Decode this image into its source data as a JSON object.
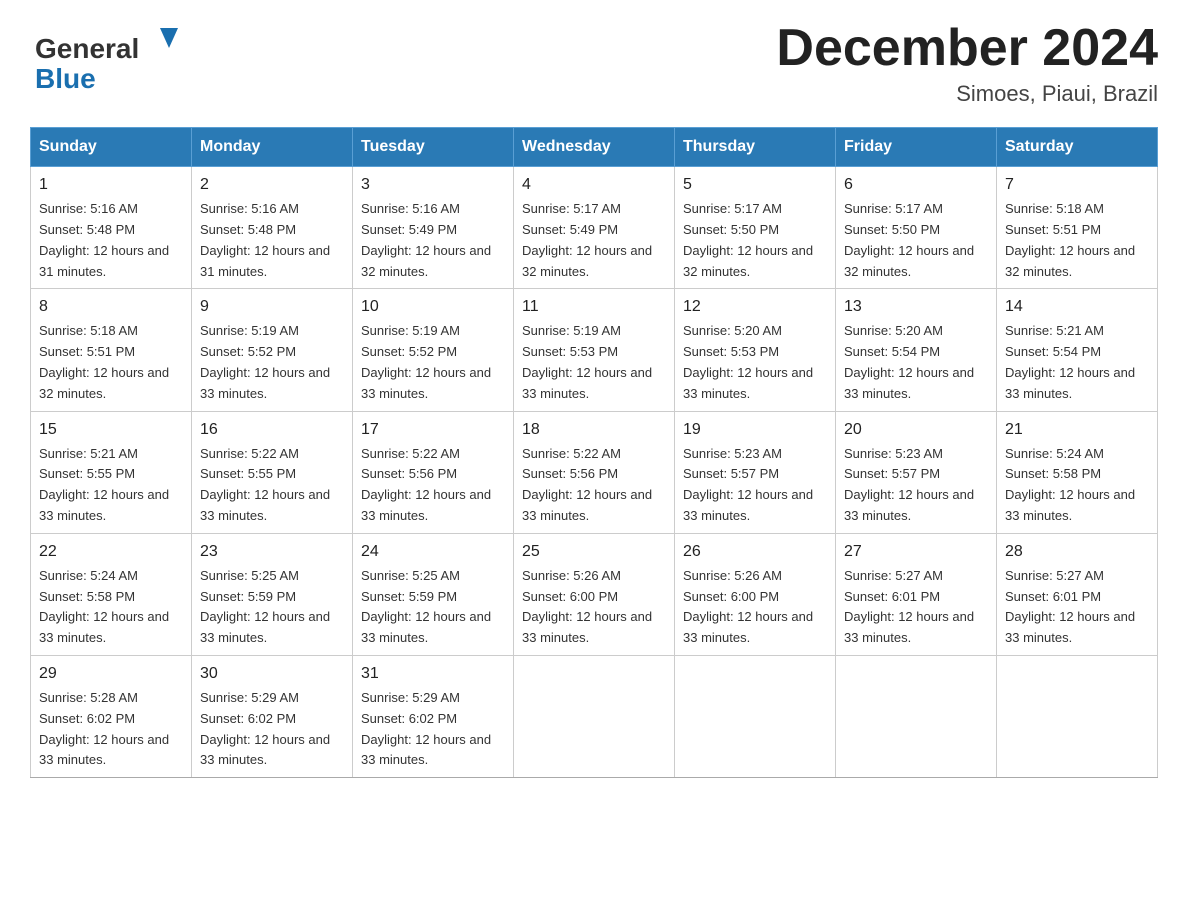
{
  "logo": {
    "general": "General",
    "blue": "Blue"
  },
  "title": {
    "month_year": "December 2024",
    "location": "Simoes, Piaui, Brazil"
  },
  "weekdays": [
    "Sunday",
    "Monday",
    "Tuesday",
    "Wednesday",
    "Thursday",
    "Friday",
    "Saturday"
  ],
  "weeks": [
    [
      {
        "day": "1",
        "sunrise": "Sunrise: 5:16 AM",
        "sunset": "Sunset: 5:48 PM",
        "daylight": "Daylight: 12 hours and 31 minutes."
      },
      {
        "day": "2",
        "sunrise": "Sunrise: 5:16 AM",
        "sunset": "Sunset: 5:48 PM",
        "daylight": "Daylight: 12 hours and 31 minutes."
      },
      {
        "day": "3",
        "sunrise": "Sunrise: 5:16 AM",
        "sunset": "Sunset: 5:49 PM",
        "daylight": "Daylight: 12 hours and 32 minutes."
      },
      {
        "day": "4",
        "sunrise": "Sunrise: 5:17 AM",
        "sunset": "Sunset: 5:49 PM",
        "daylight": "Daylight: 12 hours and 32 minutes."
      },
      {
        "day": "5",
        "sunrise": "Sunrise: 5:17 AM",
        "sunset": "Sunset: 5:50 PM",
        "daylight": "Daylight: 12 hours and 32 minutes."
      },
      {
        "day": "6",
        "sunrise": "Sunrise: 5:17 AM",
        "sunset": "Sunset: 5:50 PM",
        "daylight": "Daylight: 12 hours and 32 minutes."
      },
      {
        "day": "7",
        "sunrise": "Sunrise: 5:18 AM",
        "sunset": "Sunset: 5:51 PM",
        "daylight": "Daylight: 12 hours and 32 minutes."
      }
    ],
    [
      {
        "day": "8",
        "sunrise": "Sunrise: 5:18 AM",
        "sunset": "Sunset: 5:51 PM",
        "daylight": "Daylight: 12 hours and 32 minutes."
      },
      {
        "day": "9",
        "sunrise": "Sunrise: 5:19 AM",
        "sunset": "Sunset: 5:52 PM",
        "daylight": "Daylight: 12 hours and 33 minutes."
      },
      {
        "day": "10",
        "sunrise": "Sunrise: 5:19 AM",
        "sunset": "Sunset: 5:52 PM",
        "daylight": "Daylight: 12 hours and 33 minutes."
      },
      {
        "day": "11",
        "sunrise": "Sunrise: 5:19 AM",
        "sunset": "Sunset: 5:53 PM",
        "daylight": "Daylight: 12 hours and 33 minutes."
      },
      {
        "day": "12",
        "sunrise": "Sunrise: 5:20 AM",
        "sunset": "Sunset: 5:53 PM",
        "daylight": "Daylight: 12 hours and 33 minutes."
      },
      {
        "day": "13",
        "sunrise": "Sunrise: 5:20 AM",
        "sunset": "Sunset: 5:54 PM",
        "daylight": "Daylight: 12 hours and 33 minutes."
      },
      {
        "day": "14",
        "sunrise": "Sunrise: 5:21 AM",
        "sunset": "Sunset: 5:54 PM",
        "daylight": "Daylight: 12 hours and 33 minutes."
      }
    ],
    [
      {
        "day": "15",
        "sunrise": "Sunrise: 5:21 AM",
        "sunset": "Sunset: 5:55 PM",
        "daylight": "Daylight: 12 hours and 33 minutes."
      },
      {
        "day": "16",
        "sunrise": "Sunrise: 5:22 AM",
        "sunset": "Sunset: 5:55 PM",
        "daylight": "Daylight: 12 hours and 33 minutes."
      },
      {
        "day": "17",
        "sunrise": "Sunrise: 5:22 AM",
        "sunset": "Sunset: 5:56 PM",
        "daylight": "Daylight: 12 hours and 33 minutes."
      },
      {
        "day": "18",
        "sunrise": "Sunrise: 5:22 AM",
        "sunset": "Sunset: 5:56 PM",
        "daylight": "Daylight: 12 hours and 33 minutes."
      },
      {
        "day": "19",
        "sunrise": "Sunrise: 5:23 AM",
        "sunset": "Sunset: 5:57 PM",
        "daylight": "Daylight: 12 hours and 33 minutes."
      },
      {
        "day": "20",
        "sunrise": "Sunrise: 5:23 AM",
        "sunset": "Sunset: 5:57 PM",
        "daylight": "Daylight: 12 hours and 33 minutes."
      },
      {
        "day": "21",
        "sunrise": "Sunrise: 5:24 AM",
        "sunset": "Sunset: 5:58 PM",
        "daylight": "Daylight: 12 hours and 33 minutes."
      }
    ],
    [
      {
        "day": "22",
        "sunrise": "Sunrise: 5:24 AM",
        "sunset": "Sunset: 5:58 PM",
        "daylight": "Daylight: 12 hours and 33 minutes."
      },
      {
        "day": "23",
        "sunrise": "Sunrise: 5:25 AM",
        "sunset": "Sunset: 5:59 PM",
        "daylight": "Daylight: 12 hours and 33 minutes."
      },
      {
        "day": "24",
        "sunrise": "Sunrise: 5:25 AM",
        "sunset": "Sunset: 5:59 PM",
        "daylight": "Daylight: 12 hours and 33 minutes."
      },
      {
        "day": "25",
        "sunrise": "Sunrise: 5:26 AM",
        "sunset": "Sunset: 6:00 PM",
        "daylight": "Daylight: 12 hours and 33 minutes."
      },
      {
        "day": "26",
        "sunrise": "Sunrise: 5:26 AM",
        "sunset": "Sunset: 6:00 PM",
        "daylight": "Daylight: 12 hours and 33 minutes."
      },
      {
        "day": "27",
        "sunrise": "Sunrise: 5:27 AM",
        "sunset": "Sunset: 6:01 PM",
        "daylight": "Daylight: 12 hours and 33 minutes."
      },
      {
        "day": "28",
        "sunrise": "Sunrise: 5:27 AM",
        "sunset": "Sunset: 6:01 PM",
        "daylight": "Daylight: 12 hours and 33 minutes."
      }
    ],
    [
      {
        "day": "29",
        "sunrise": "Sunrise: 5:28 AM",
        "sunset": "Sunset: 6:02 PM",
        "daylight": "Daylight: 12 hours and 33 minutes."
      },
      {
        "day": "30",
        "sunrise": "Sunrise: 5:29 AM",
        "sunset": "Sunset: 6:02 PM",
        "daylight": "Daylight: 12 hours and 33 minutes."
      },
      {
        "day": "31",
        "sunrise": "Sunrise: 5:29 AM",
        "sunset": "Sunset: 6:02 PM",
        "daylight": "Daylight: 12 hours and 33 minutes."
      },
      null,
      null,
      null,
      null
    ]
  ]
}
